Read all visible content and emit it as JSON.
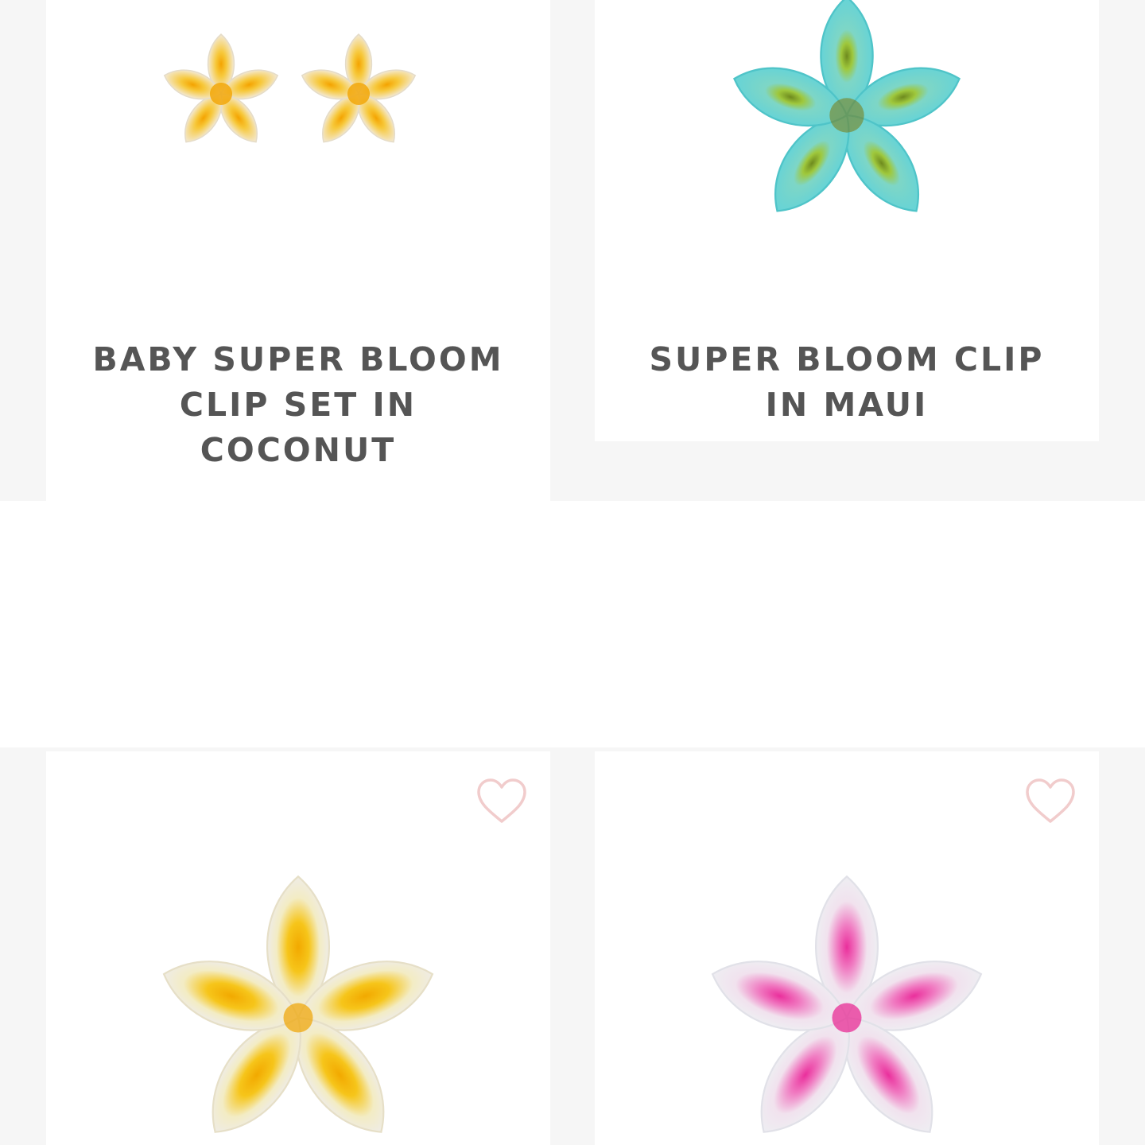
{
  "products": [
    {
      "title_lines": [
        "BABY SUPER BLOOM",
        "CLIP SET IN",
        "COCONUT"
      ],
      "image": "flower-clip-pair-yellow",
      "favorite_icon": null
    },
    {
      "title_lines": [
        "SUPER BLOOM CLIP",
        "IN MAUI"
      ],
      "image": "flower-clip-teal",
      "favorite_icon": null
    },
    {
      "title_lines": [],
      "image": "flower-clip-yellow",
      "favorite_icon": "heart-outline-icon"
    },
    {
      "title_lines": [],
      "image": "flower-clip-pink",
      "favorite_icon": "heart-outline-icon"
    }
  ],
  "colors": {
    "title_text": "#555555",
    "heart_outline": "#f1cccc",
    "page_background": "#f6f6f6",
    "card_background": "#ffffff"
  }
}
